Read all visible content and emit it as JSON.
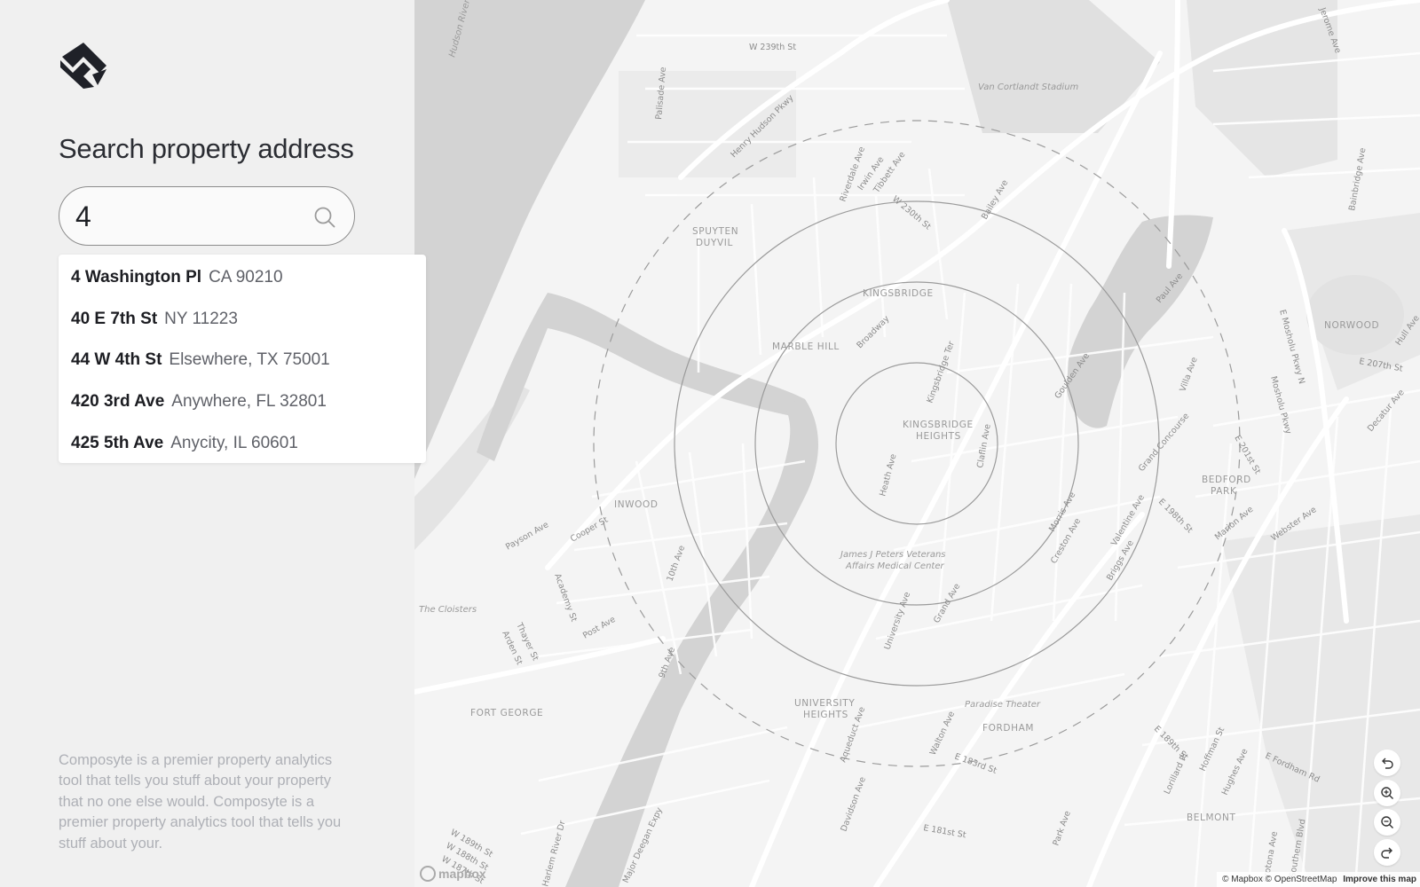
{
  "colors": {
    "sidebar_bg": "#f0f0f0",
    "heading_text": "#2b2d33",
    "muted_text": "#aeb0b6",
    "map_bg": "#f4f4f4",
    "water": "#d4d4d4",
    "radius_ring": "#9b9b9b"
  },
  "brand": {
    "logo_icon": "composyte-logo-icon"
  },
  "search": {
    "heading": "Search property address",
    "value": "4",
    "icon": "search-icon"
  },
  "suggestions": [
    {
      "street": "4 Washington Pl",
      "locality": "CA 90210"
    },
    {
      "street": "40 E 7th St",
      "locality": "NY 11223"
    },
    {
      "street": "44 W 4th St",
      "locality": "Elsewhere, TX 75001"
    },
    {
      "street": "420 3rd Ave",
      "locality": "Anywhere, FL 32801"
    },
    {
      "street": "425 5th Ave",
      "locality": "Anycity, IL 60601"
    }
  ],
  "blurb": "Composyte is a premier property analytics tool that tells you stuff about your property that no one else would. Composyte is a premier property analytics tool that tells you stuff about your.",
  "map": {
    "neighborhoods": [
      "SPUYTEN DUYVIL",
      "KINGSBRIDGE",
      "MARBLE HILL",
      "KINGSBRIDGE HEIGHTS",
      "INWOOD",
      "BEDFORD PARK",
      "NORWOOD",
      "UNIVERSITY HEIGHTS",
      "FORDHAM",
      "FORT GEORGE",
      "BELMONT"
    ],
    "places": [
      "Van Cortlandt Stadium",
      "James J Peters Veterans Affairs Medical Center",
      "Paradise Theater",
      "The Cloisters"
    ],
    "streets": [
      "W 239th St",
      "Hudson River",
      "Henry Hudson Pkwy",
      "Palisade Ave",
      "Riverdale Ave",
      "Irwin Ave",
      "Tibbett Ave",
      "W 230th St",
      "Bailey Ave",
      "Broadway",
      "Kingsbridge Ter",
      "Goulden Ave",
      "Paul Ave",
      "Bainbridge Ave",
      "Jerome Ave",
      "Mosholu Pkwy",
      "E Mosholu Pkwy N",
      "E 207th St",
      "Villa Ave",
      "Grand Concourse",
      "E 201st St",
      "E 198th St",
      "Decatur Ave",
      "Webster Ave",
      "Marion Ave",
      "Valentine Ave",
      "Briggs Ave",
      "Creston Ave",
      "Morris Ave",
      "Heath Ave",
      "Claflin Ave",
      "Payson Ave",
      "Cooper St",
      "Academy St",
      "10th Ave",
      "Post Ave",
      "Thayer St",
      "Arden St",
      "9th Ave",
      "University Ave",
      "Grand Ave",
      "Aqueduct Ave",
      "Walton Ave",
      "E 183rd St",
      "E 189th St",
      "Lorillard Pl",
      "Hoffman St",
      "Hughes Ave",
      "E Fordham Rd",
      "Crotona Ave",
      "Southern Blvd",
      "Park Ave",
      "E 181st St",
      "Davidson Ave",
      "Major Deegan Expy",
      "Harlem River Dr",
      "W 189th St",
      "W 188th St",
      "W 187th St",
      "Hull Ave"
    ]
  },
  "map_controls": [
    {
      "name": "rotate-left-button",
      "icon": "rotate-left-icon"
    },
    {
      "name": "zoom-in-button",
      "icon": "zoom-in-icon"
    },
    {
      "name": "zoom-out-button",
      "icon": "zoom-out-icon"
    },
    {
      "name": "rotate-right-button",
      "icon": "rotate-right-icon"
    }
  ],
  "attribution": {
    "mapbox": "© Mapbox",
    "osm": "© OpenStreetMap",
    "improve": "Improve this map",
    "logo_text": "mapbox"
  }
}
